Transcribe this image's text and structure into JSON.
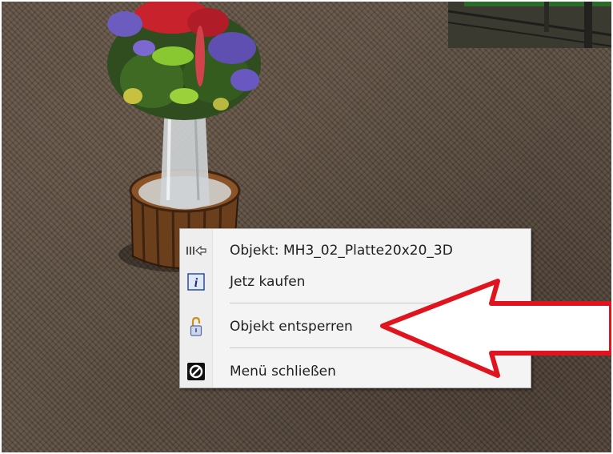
{
  "context_menu": {
    "items": [
      {
        "label": "Objekt: MH3_02_Platte20x20_3D",
        "icon": "arrow-right-icon"
      },
      {
        "label": "Jetz kaufen",
        "icon": "info-icon"
      },
      {
        "label": "Objekt entsperren",
        "icon": "padlock-icon"
      },
      {
        "label": "Menü schließen",
        "icon": "no-symbol-icon"
      }
    ]
  },
  "annotation": {
    "arrow_color": "#e0141e",
    "points_to": "Objekt entsperren"
  },
  "colors": {
    "floor": "#5b4d40",
    "menu_background": "#f4f4f4",
    "menu_text": "#202020"
  }
}
